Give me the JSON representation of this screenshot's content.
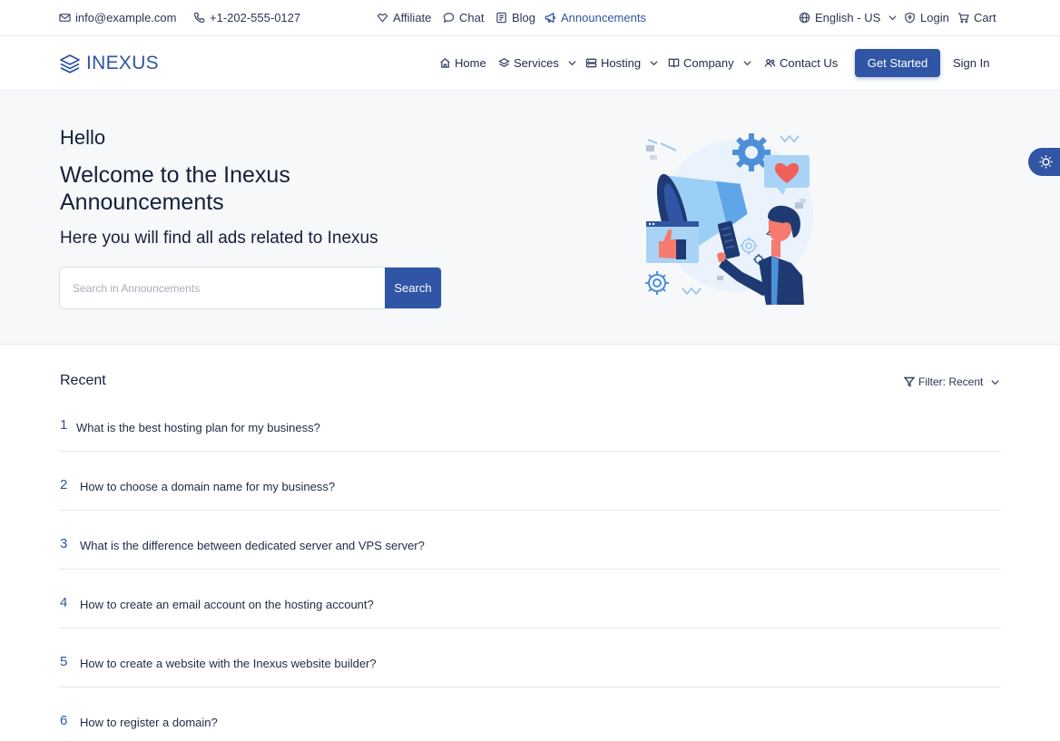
{
  "topbar": {
    "email": "info@example.com",
    "phone": "+1-202-555-0127",
    "links": [
      "Affiliate",
      "Chat",
      "Blog",
      "Announcements"
    ],
    "language": "English - US",
    "login": "Login",
    "cart": "Cart"
  },
  "nav": {
    "logo": "INEXUS",
    "items": [
      "Home",
      "Services",
      "Hosting",
      "Company",
      "Contact Us"
    ],
    "cta": "Get Started",
    "signin": "Sign In"
  },
  "hero": {
    "greeting": "Hello",
    "title": "Welcome to the Inexus Announcements",
    "subtitle": "Here you will find all ads related to Inexus",
    "search_placeholder": "Search in Announcements",
    "search_button": "Search"
  },
  "list": {
    "heading": "Recent",
    "filter": "Filter: Recent",
    "items": [
      {
        "num": "1",
        "text": "What is the best hosting plan for my business?"
      },
      {
        "num": "2",
        "text": "How to choose a domain name for my business?"
      },
      {
        "num": "3",
        "text": "What is the difference between dedicated server and VPS server?"
      },
      {
        "num": "4",
        "text": "How to create an email account on the hosting account?"
      },
      {
        "num": "5",
        "text": "How to create a website with the Inexus website builder?"
      },
      {
        "num": "6",
        "text": "How to register a domain?"
      }
    ]
  },
  "colors": {
    "brand": "#2f55a4",
    "text": "#14203a",
    "hero_bg": "#f7f8fa"
  },
  "icons": [
    "mail-icon",
    "phone-icon",
    "affiliate-icon",
    "chat-icon",
    "blog-icon",
    "megaphone-icon",
    "globe-icon",
    "shield-icon",
    "cart-icon",
    "layers-logo-icon",
    "home-icon",
    "services-icon",
    "hosting-icon",
    "company-icon",
    "users-icon",
    "sun-icon",
    "filter-icon",
    "chevron-down-icon"
  ]
}
